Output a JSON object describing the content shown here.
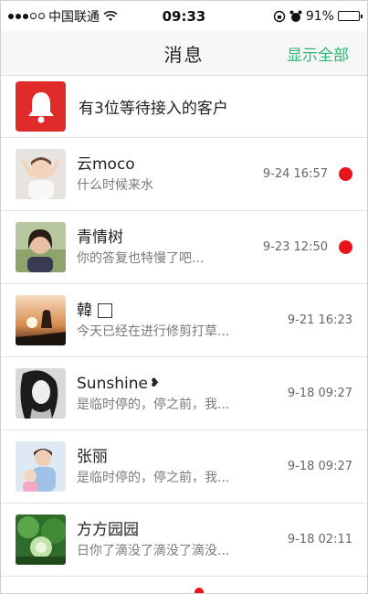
{
  "status_bar": {
    "carrier": "中国联通",
    "time": "09:33",
    "battery": "91%",
    "battery_level": 0.91
  },
  "header": {
    "title": "消息",
    "action": "显示全部"
  },
  "alert": {
    "text": "有3位等待接入的客户"
  },
  "colors": {
    "accent_green": "#2bb673",
    "alert_red": "#e02b2b",
    "unread_dot": "#e8141a"
  },
  "conversations": [
    {
      "name": "云moco",
      "preview": "什么时候来水",
      "time": "9-24 16:57",
      "unread": true
    },
    {
      "name": "青情树",
      "preview": "你的答复也特慢了吧...",
      "time": "9-23 12:50",
      "unread": true
    },
    {
      "name": "韓",
      "preview": "今天已经在进行修剪打草...",
      "time": "9-21 16:23",
      "unread": false
    },
    {
      "name": "Sunshine",
      "preview": "是临时停的，停之前，我...",
      "time": "9-18 09:27",
      "unread": false
    },
    {
      "name": "张丽",
      "preview": "是临时停的，停之前，我...",
      "time": "9-18 09:27",
      "unread": false
    },
    {
      "name": "方方园园",
      "preview": "日你了滴没了滴没了滴没...",
      "time": "9-18 02:11",
      "unread": false
    }
  ]
}
